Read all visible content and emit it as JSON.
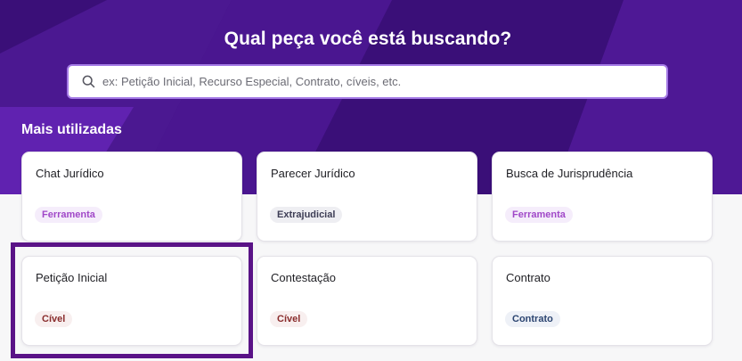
{
  "hero": {
    "title": "Qual peça você está buscando?",
    "colors": {
      "base": "#3a0f78",
      "band": "#5a20a5",
      "accent": "#7b2fd6"
    }
  },
  "search": {
    "placeholder": "ex: Petição Inicial, Recurso Especial, Contrato, cíveis, etc.",
    "value": "",
    "icon": "search-icon"
  },
  "section": {
    "title": "Mais utilizadas"
  },
  "cards": [
    {
      "title": "Chat Jurídico",
      "badge": "Ferramenta",
      "badge_type": "tool"
    },
    {
      "title": "Parecer Jurídico",
      "badge": "Extrajudicial",
      "badge_type": "extra"
    },
    {
      "title": "Busca de Jurisprudência",
      "badge": "Ferramenta",
      "badge_type": "tool"
    },
    {
      "title": "Petição Inicial",
      "badge": "Cível",
      "badge_type": "civel"
    },
    {
      "title": "Contestação",
      "badge": "Cível",
      "badge_type": "civel"
    },
    {
      "title": "Contrato",
      "badge": "Contrato",
      "badge_type": "contrato"
    }
  ],
  "highlighted_card": "Petição Inicial",
  "highlight_color": "#5a1387"
}
